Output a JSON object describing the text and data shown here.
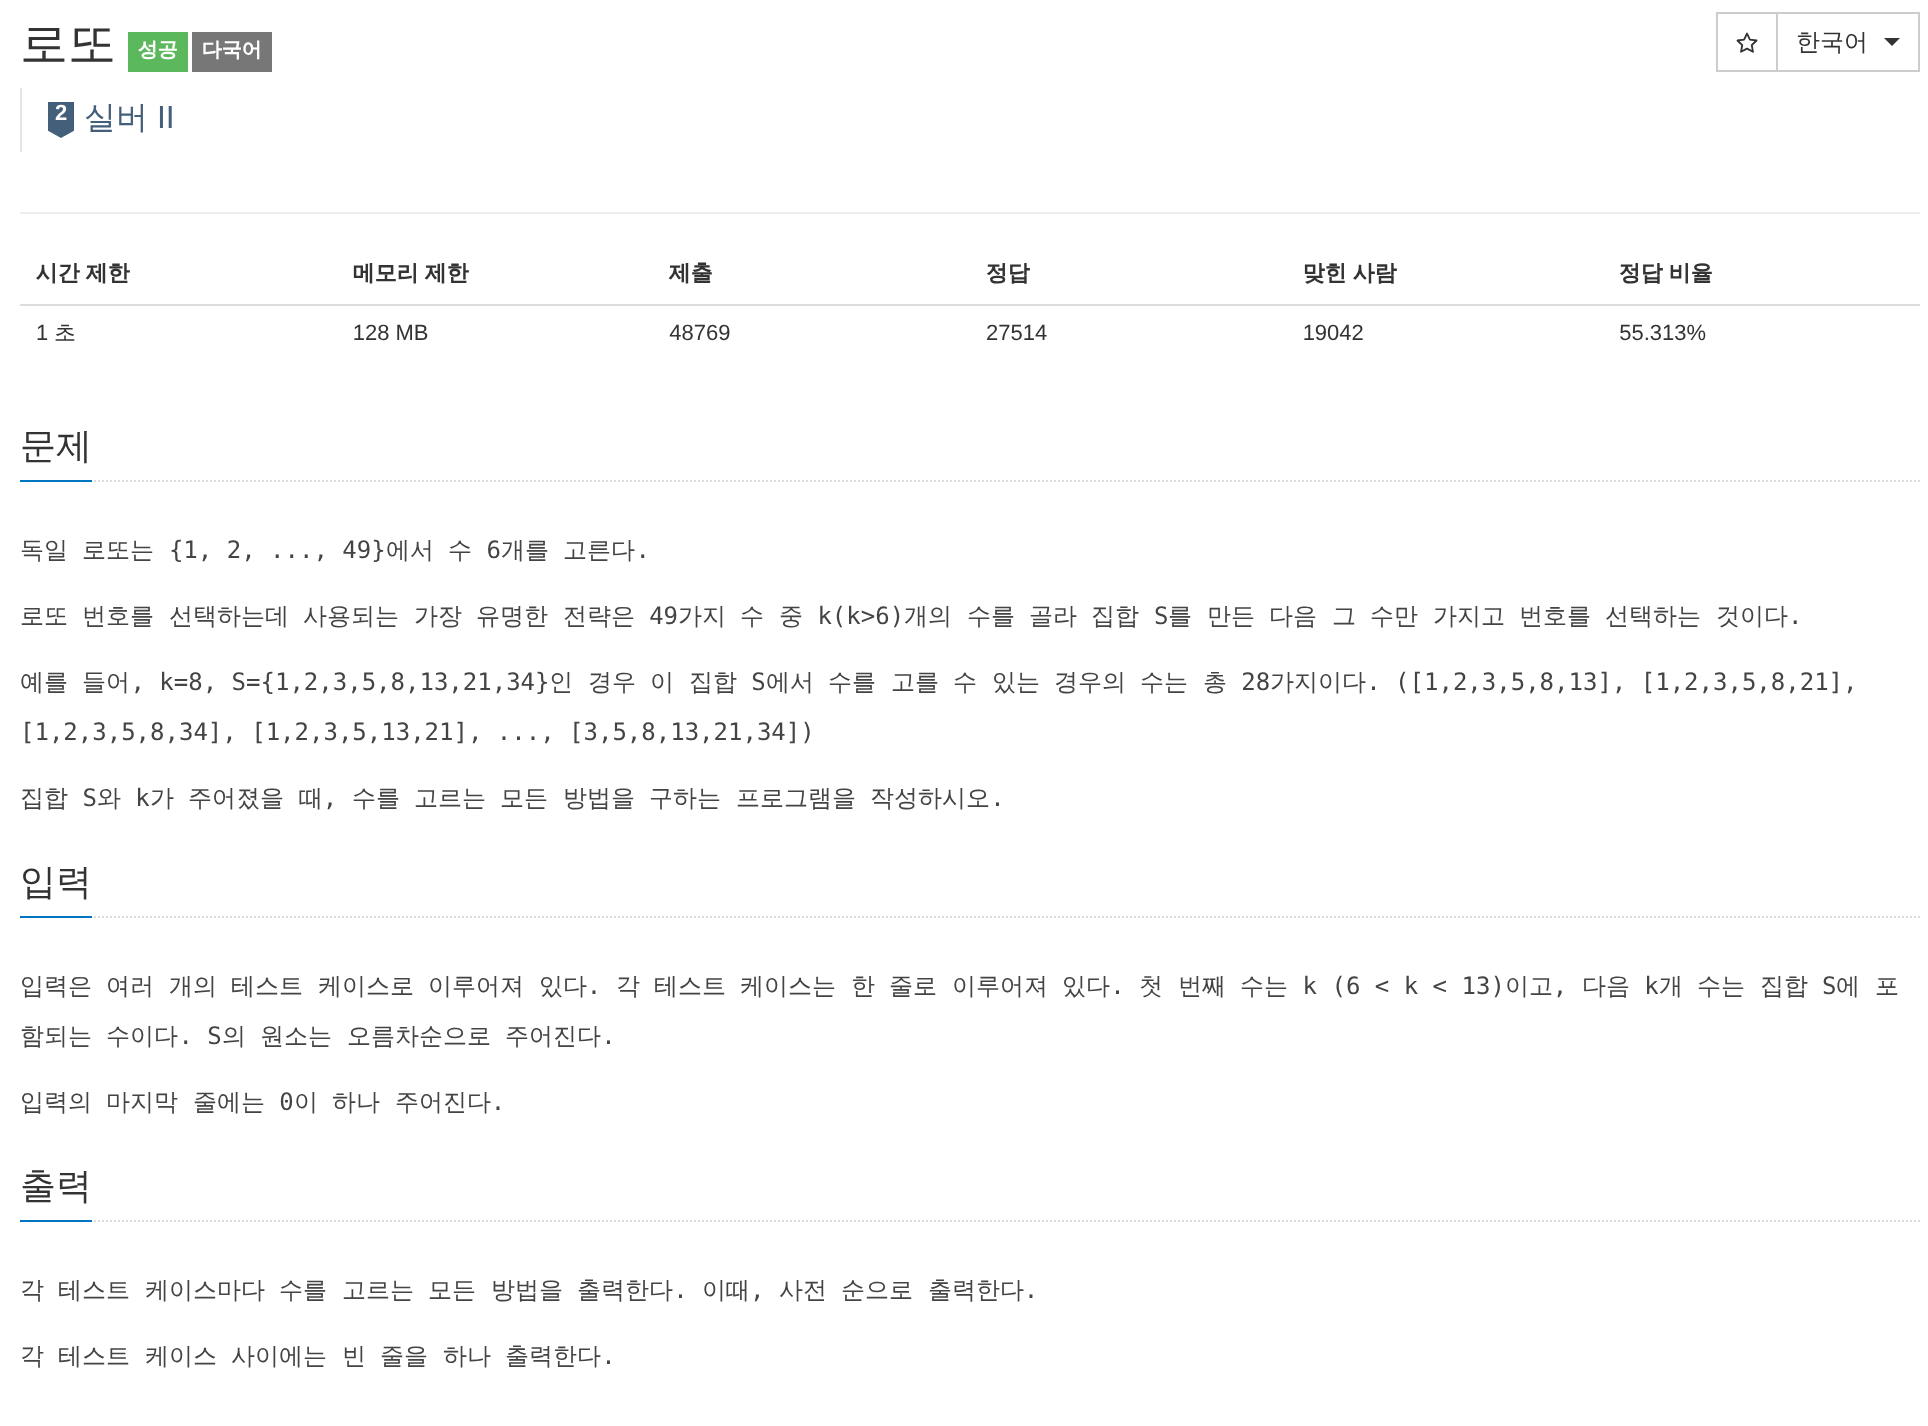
{
  "header": {
    "title": "로또",
    "badges": [
      {
        "label": "성공",
        "kind": "success"
      },
      {
        "label": "다국어",
        "kind": "neutral"
      }
    ],
    "tier": {
      "kind": "silver",
      "number": "2",
      "name": "실버 II"
    }
  },
  "language_menu": {
    "value": "한국어"
  },
  "stats": {
    "columns": [
      "시간 제한",
      "메모리 제한",
      "제출",
      "정답",
      "맞힌 사람",
      "정답 비율"
    ],
    "rows": [
      [
        "1 초",
        "128 MB",
        "48769",
        "27514",
        "19042",
        "55.313%"
      ]
    ]
  },
  "sections": [
    {
      "heading": "문제",
      "paragraphs": [
        "독일 로또는 {1, 2, ..., 49}에서 수 6개를 고른다.",
        "로또 번호를 선택하는데 사용되는 가장 유명한 전략은 49가지 수 중 k(k>6)개의 수를 골라 집합 S를 만든 다음 그 수만 가지고 번호를 선택하는 것이다.",
        "예를 들어, k=8, S={1,2,3,5,8,13,21,34}인 경우 이 집합 S에서 수를 고를 수 있는 경우의 수는 총 28가지이다. ([1,2,3,5,8,13], [1,2,3,5,8,21], [1,2,3,5,8,34], [1,2,3,5,13,21], ..., [3,5,8,13,21,34])",
        "집합 S와 k가 주어졌을 때, 수를 고르는 모든 방법을 구하는 프로그램을 작성하시오."
      ]
    },
    {
      "heading": "입력",
      "paragraphs": [
        "입력은 여러 개의 테스트 케이스로 이루어져 있다. 각 테스트 케이스는 한 줄로 이루어져 있다. 첫 번째 수는 k (6 < k < 13)이고, 다음 k개 수는 집합 S에 포함되는 수이다. S의 원소는 오름차순으로 주어진다.",
        "입력의 마지막 줄에는 0이 하나 주어진다."
      ]
    },
    {
      "heading": "출력",
      "paragraphs": [
        "각 테스트 케이스마다 수를 고르는 모든 방법을 출력한다. 이때, 사전 순으로 출력한다.",
        "각 테스트 케이스 사이에는 빈 줄을 하나 출력한다."
      ]
    }
  ]
}
